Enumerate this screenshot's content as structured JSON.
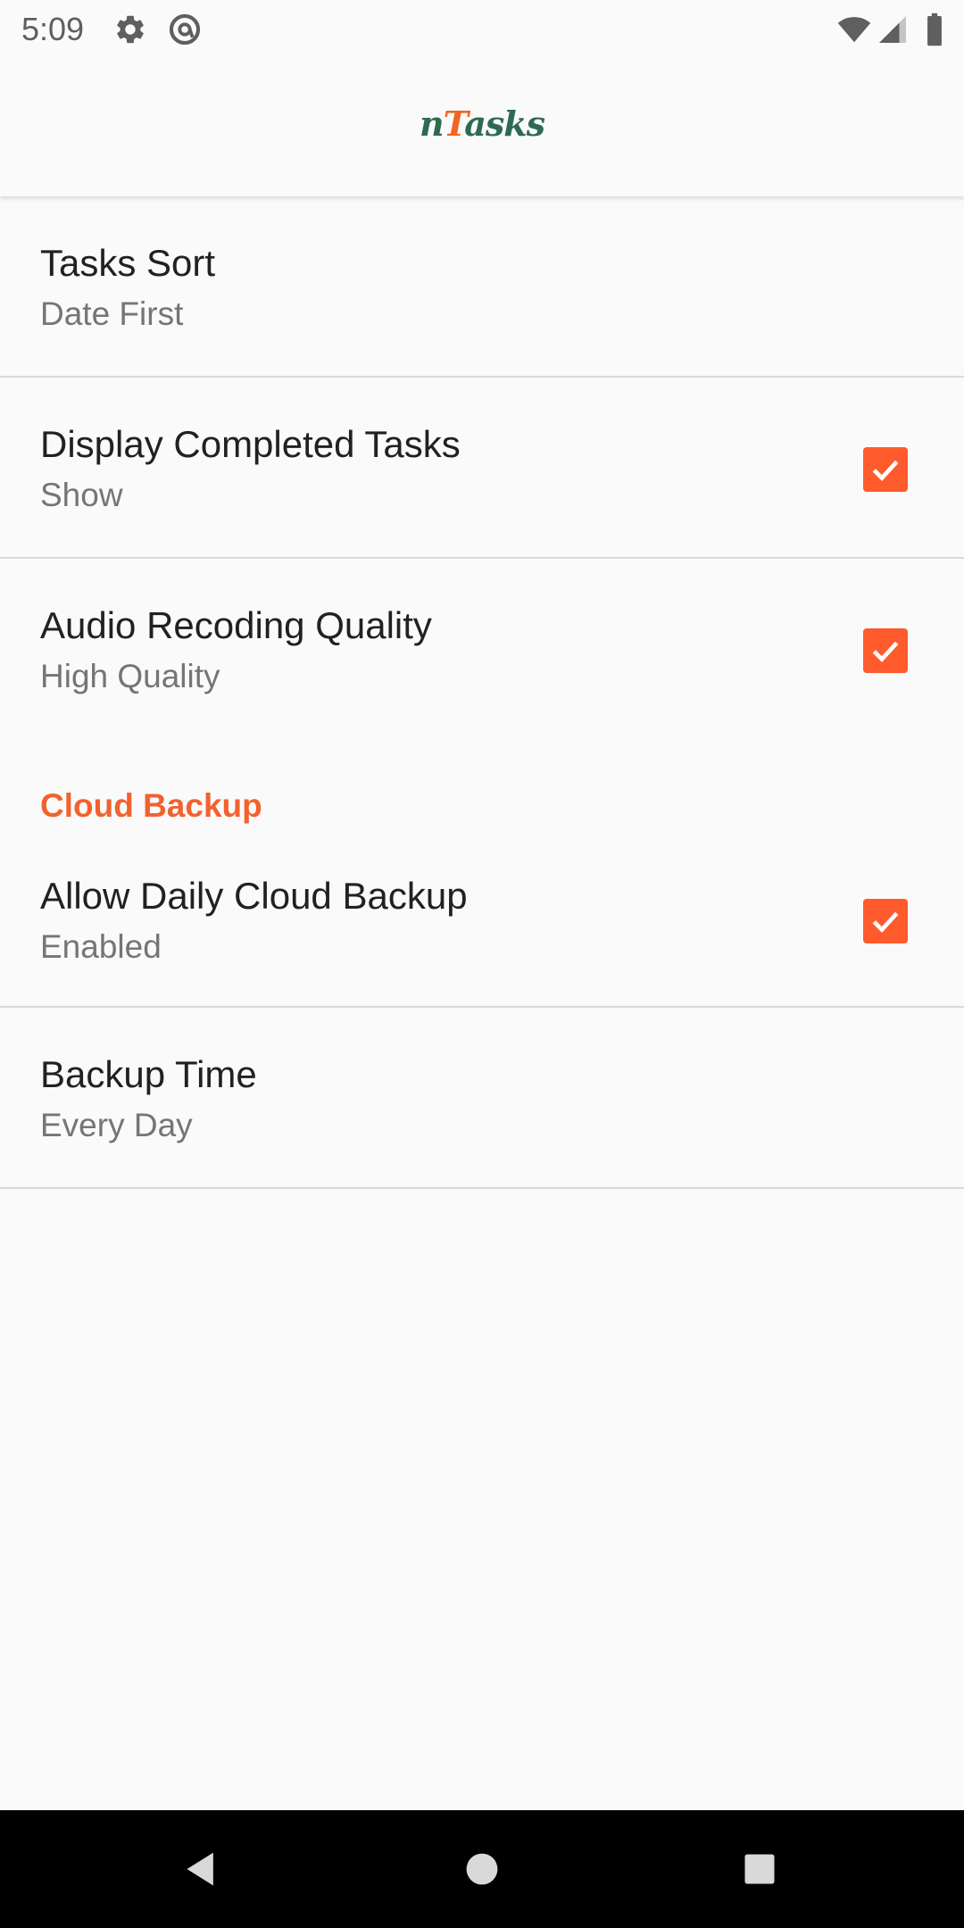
{
  "status_bar": {
    "time": "5:09",
    "icons": [
      "gear-icon",
      "at-sign-icon",
      "wifi-icon",
      "cell-signal-icon",
      "battery-icon"
    ]
  },
  "app_bar": {
    "logo_n": "n",
    "logo_t": "T",
    "logo_rest": "asks"
  },
  "preferences": {
    "tasks_sort": {
      "title": "Tasks Sort",
      "summary": "Date First"
    },
    "display_completed": {
      "title": "Display Completed Tasks",
      "summary": "Show",
      "checked": true
    },
    "audio_quality": {
      "title": "Audio Recoding Quality",
      "summary": "High Quality",
      "checked": true
    },
    "cloud_category": {
      "title": "Cloud Backup"
    },
    "daily_backup": {
      "title": "Allow Daily Cloud Backup",
      "summary": "Enabled",
      "checked": true
    },
    "backup_time": {
      "title": "Backup Time",
      "summary": "Every Day"
    }
  },
  "colors": {
    "accent": "#ff5a2c",
    "logo_green": "#2e6a52",
    "background": "#fafafa"
  },
  "nav_bar": {
    "buttons": [
      "back-icon",
      "home-icon",
      "recents-icon"
    ]
  }
}
